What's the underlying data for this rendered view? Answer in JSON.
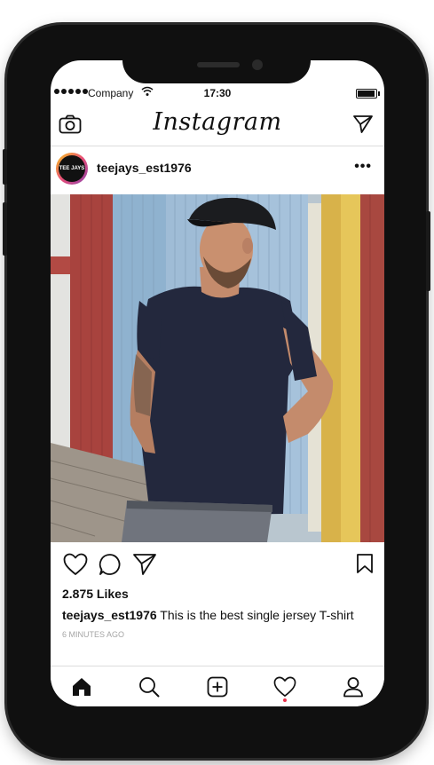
{
  "status_bar": {
    "carrier": "Company",
    "time": "17:30",
    "battery_level": 0.95
  },
  "header": {
    "logo": "Instagram",
    "left_icon": "camera-icon",
    "right_icon": "direct-message-icon"
  },
  "post": {
    "username": "teejays_est1976",
    "avatar_text": "TEE JAYS",
    "more_label": "•••",
    "likes": "2.875 Likes",
    "caption_user": "teejays_est1976",
    "caption_text": " This is the best single jersey T-shirt",
    "time_ago": "6 MINUTES AGO",
    "action_icons": [
      "heart-icon",
      "comment-icon",
      "share-icon",
      "bookmark-icon"
    ]
  },
  "tabbar": {
    "items": [
      "home-icon",
      "search-icon",
      "add-post-icon",
      "activity-heart-icon",
      "profile-icon"
    ],
    "notification_color": "#e8304b"
  },
  "colors": {
    "text": "#111111",
    "divider": "#dcdcdc",
    "muted": "#a5a5a5"
  }
}
